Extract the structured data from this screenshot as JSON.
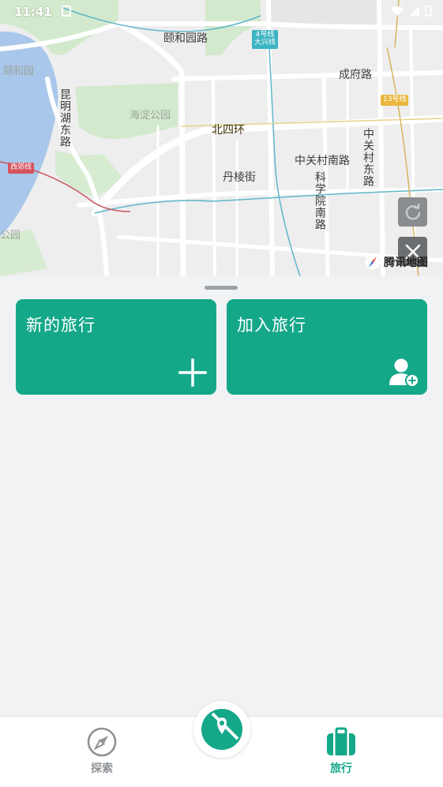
{
  "status_bar": {
    "time": "11:41"
  },
  "map": {
    "labels": {
      "yiheyuan_road": "颐和园路",
      "yiheyuan": "颐和园",
      "chengfu_road": "成府路",
      "kunming_lake_east_road": "昆明湖东路",
      "haidian_park": "海淀公园",
      "north_4th_ring": "北四环",
      "zhongguancun_south_road": "中关村南路",
      "zhongguancun_east_road": "中关村东路",
      "danleng_street": "丹棱街",
      "kexueyuan_south_road": "科学院南路",
      "park_fragment": "公园"
    },
    "metro": {
      "line4": "4号线",
      "line4_sub": "大兴线",
      "line13": "13号线",
      "xijiao": "西郊线"
    },
    "logo_text": "腾讯地图",
    "colors": {
      "water": "#a9c7ea",
      "green": "#cfe8c9",
      "road": "#ffffff",
      "metro_line": "#5fb6c9"
    }
  },
  "sheet": {
    "cards": [
      {
        "title": "新的旅行",
        "icon": "plus-icon"
      },
      {
        "title": "加入旅行",
        "icon": "add-user-icon"
      }
    ],
    "accent": "#14a889"
  },
  "tabbar": {
    "tabs": [
      {
        "label": "探索",
        "icon": "compass-icon",
        "active": false
      },
      {
        "label": "旅行",
        "icon": "suitcase-icon",
        "active": true
      }
    ],
    "center_icon": "map-pin-icon"
  }
}
